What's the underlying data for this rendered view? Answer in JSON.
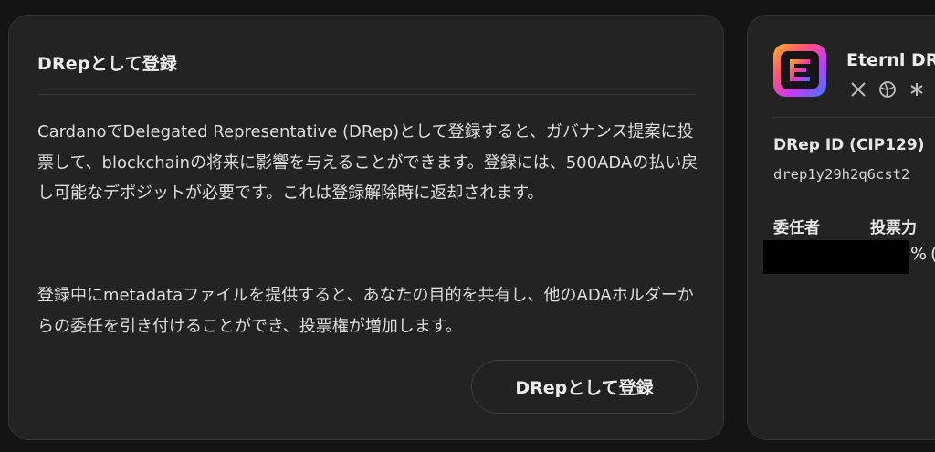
{
  "register_card": {
    "title": "DRepとして登録",
    "paragraph1": "CardanoでDelegated Representative (DRep)として登録すると、ガバナンス提案に投票して、blockchainの将来に影響を与えることができます。登録には、500ADAの払い戻し可能なデポジットが必要です。これは登録解除時に返却されます。",
    "paragraph2": "登録中にmetadataファイルを提供すると、あなたの目的を共有し、他のADAホルダーからの委任を引き付けることができ、投票権が増加します。",
    "button_label": "DRepとして登録"
  },
  "wallet_card": {
    "name": "Eternl DR",
    "icons": [
      "x-icon",
      "globe-icon",
      "asterisk-icon"
    ],
    "drep_id_label": "DRep ID (CIP129)",
    "drep_id_value": "drep1y29h2q6cst2",
    "delegators_label": "委任者",
    "voting_power_label": "投票力",
    "voting_power_suffix": "%",
    "voting_power_tail": "("
  },
  "colors": {
    "background": "#141414",
    "card": "#232323",
    "border": "#343434",
    "text": "#e6e6e6"
  }
}
